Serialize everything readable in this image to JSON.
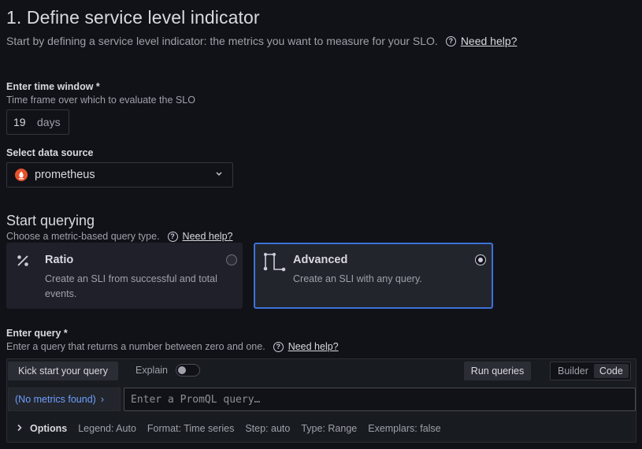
{
  "header": {
    "title": "1. Define service level indicator",
    "subtitle": "Start by defining a service level indicator: the metrics you want to measure for your SLO.",
    "help_link": "Need help?"
  },
  "time_window": {
    "label": "Enter time window *",
    "description": "Time frame over which to evaluate the SLO",
    "value": "19",
    "unit": "days"
  },
  "data_source": {
    "label": "Select data source",
    "selected": "prometheus",
    "icon": "prometheus-icon",
    "brand_color": "#e6522c"
  },
  "querying": {
    "title": "Start querying",
    "subtitle": "Choose a metric-based query type.",
    "help_link": "Need help?",
    "options": [
      {
        "title": "Ratio",
        "description": "Create an SLI from successful and total events.",
        "icon": "percent-icon",
        "selected": false
      },
      {
        "title": "Advanced",
        "description": "Create an SLI with any query.",
        "icon": "flow-icon",
        "selected": true
      }
    ],
    "accent_color": "#3d71d9"
  },
  "query": {
    "label": "Enter query *",
    "description": "Enter a query that returns a number between zero and one.",
    "help_link": "Need help?",
    "kick_start_label": "Kick start your query",
    "explain_label": "Explain",
    "run_label": "Run queries",
    "mode_options": [
      "Builder",
      "Code"
    ],
    "active_mode": "Code",
    "metrics_button": "(No metrics found)",
    "metrics_chevron": "›",
    "placeholder": "Enter a PromQL query…",
    "options_label": "Options",
    "options_items": [
      "Legend: Auto",
      "Format: Time series",
      "Step: auto",
      "Type: Range",
      "Exemplars: false"
    ]
  }
}
